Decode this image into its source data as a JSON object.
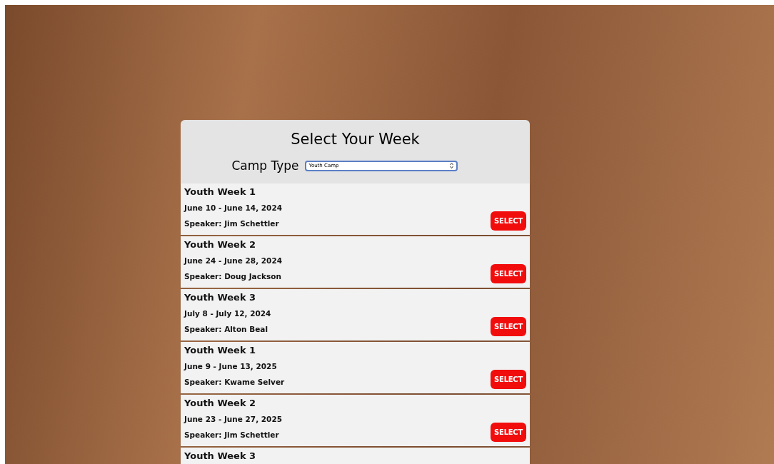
{
  "title": "Select Your Week",
  "camp_type": {
    "label": "Camp Type",
    "value": "Youth Camp"
  },
  "weeks": [
    {
      "name": "Youth Week 1",
      "dates": "June 10 - June 14, 2024",
      "speaker": "Speaker: Jim Schettler",
      "button": "SELECT"
    },
    {
      "name": "Youth Week 2",
      "dates": "June 24 - June 28, 2024",
      "speaker": "Speaker: Doug Jackson",
      "button": "SELECT"
    },
    {
      "name": "Youth Week 3",
      "dates": "July 8 - July 12, 2024",
      "speaker": "Speaker: Alton Beal",
      "button": "SELECT"
    },
    {
      "name": "Youth Week 1",
      "dates": "June 9 - June 13, 2025",
      "speaker": "Speaker: Kwame Selver",
      "button": "SELECT"
    },
    {
      "name": "Youth Week 2",
      "dates": "June 23 - June 27, 2025",
      "speaker": "Speaker: Jim Schettler",
      "button": "SELECT"
    },
    {
      "name": "Youth Week 3"
    }
  ]
}
